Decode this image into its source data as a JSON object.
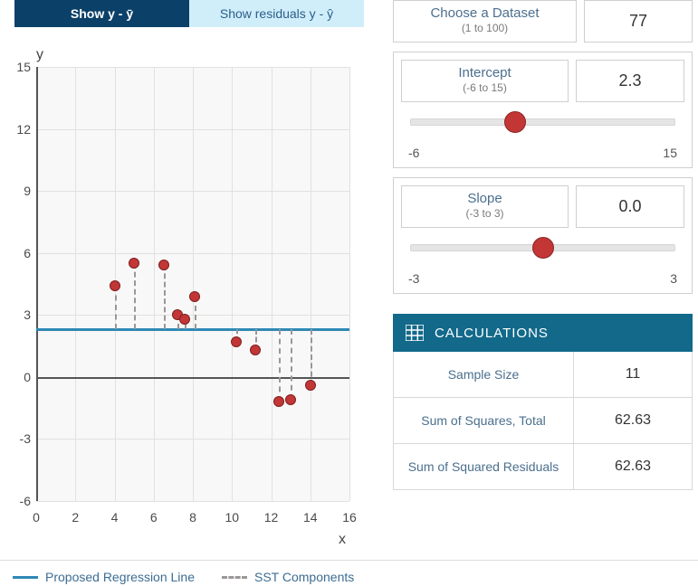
{
  "tabs": {
    "active_label": "Show y - ȳ",
    "inactive_label": "Show residuals y - ŷ"
  },
  "chart_data": {
    "type": "scatter",
    "xlabel": "x",
    "ylabel": "y",
    "xlim": [
      0,
      16
    ],
    "ylim": [
      -6,
      15
    ],
    "xticks": [
      0,
      2,
      4,
      6,
      8,
      10,
      12,
      14,
      16
    ],
    "yticks": [
      -6,
      -3,
      0,
      3,
      6,
      9,
      12,
      15
    ],
    "points": [
      {
        "x": 4.0,
        "y": 4.4
      },
      {
        "x": 5.0,
        "y": 5.5
      },
      {
        "x": 6.5,
        "y": 5.4
      },
      {
        "x": 7.2,
        "y": 3.0
      },
      {
        "x": 7.6,
        "y": 2.8
      },
      {
        "x": 8.1,
        "y": 3.9
      },
      {
        "x": 10.2,
        "y": 1.7
      },
      {
        "x": 11.2,
        "y": 1.3
      },
      {
        "x": 12.4,
        "y": -1.2
      },
      {
        "x": 13.0,
        "y": -1.1
      },
      {
        "x": 14.0,
        "y": -0.4
      }
    ],
    "mean_y": 2.3,
    "regression": {
      "slope": 0.0,
      "intercept": 2.3
    }
  },
  "legend": {
    "proposed": "Proposed Regression Line",
    "sst": "SST Components"
  },
  "controls": {
    "dataset": {
      "label": "Choose a Dataset",
      "range": "(1 to 100)",
      "value": "77"
    },
    "intercept": {
      "label": "Intercept",
      "range": "(-6 to 15)",
      "value": "2.3",
      "min": "-6",
      "max": "15",
      "pos_pct": 39.5
    },
    "slope": {
      "label": "Slope",
      "range": "(-3 to 3)",
      "value": "0.0",
      "min": "-3",
      "max": "3",
      "pos_pct": 50
    }
  },
  "calculations": {
    "title": "CALCULATIONS",
    "rows": [
      {
        "label": "Sample Size",
        "value": "11"
      },
      {
        "label": "Sum of Squares, Total",
        "value": "62.63"
      },
      {
        "label": "Sum of Squared Residuals",
        "value": "62.63"
      }
    ]
  }
}
